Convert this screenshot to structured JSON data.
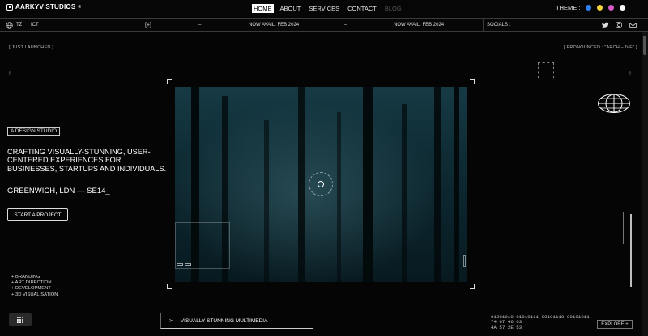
{
  "brand": {
    "name": "AARKYV STUDIOS",
    "reg": "®"
  },
  "nav": {
    "home": "HOME",
    "about": "ABOUT",
    "services": "SERVICES",
    "contact": "CONTACT",
    "blog": "BLOG"
  },
  "theme": {
    "label": "THEME :",
    "colors": [
      "#2f7ff0",
      "#f2d43a",
      "#d85ac8",
      "#ffffff"
    ]
  },
  "status": {
    "tz_label": "TZ",
    "tz_value": "ICT",
    "expand": "[+]",
    "sep1": "–",
    "avail1": "NOW AVAIL: FEB 2024",
    "sep2": "–",
    "avail2": "NOW AVAIL: FEB 2024",
    "socials": "SOCIALS :"
  },
  "hero": {
    "just_launched": "[ JUST LAUNCHED ]",
    "pronounced": "[ PRONOUNCED : \"ARCH – IVE\" ]",
    "tag": "A DESIGN STUDIO",
    "headline": "CRAFTING VISUALLY-STUNNING, USER-CENTERED EXPERIENCES FOR BUSINESSES, STARTUPS AND INDIVIDUALS.",
    "location": "GREENWICH, LDN — SE14_",
    "cta": "START A PROJECT"
  },
  "services": [
    "+ BRANDING",
    "+ ART DIRECTION",
    "+ DEVELOPMENT",
    "+ 3D VISUALISATION"
  ],
  "bottom": {
    "arrow": ">",
    "caption": "VISUALLY STUNNING MULTIMEDIA",
    "binary": [
      "01001010 01010111 00101110 00101011",
      "74 67 46 63",
      "4A 57 2E 53"
    ],
    "explore": "EXPLORE +"
  }
}
